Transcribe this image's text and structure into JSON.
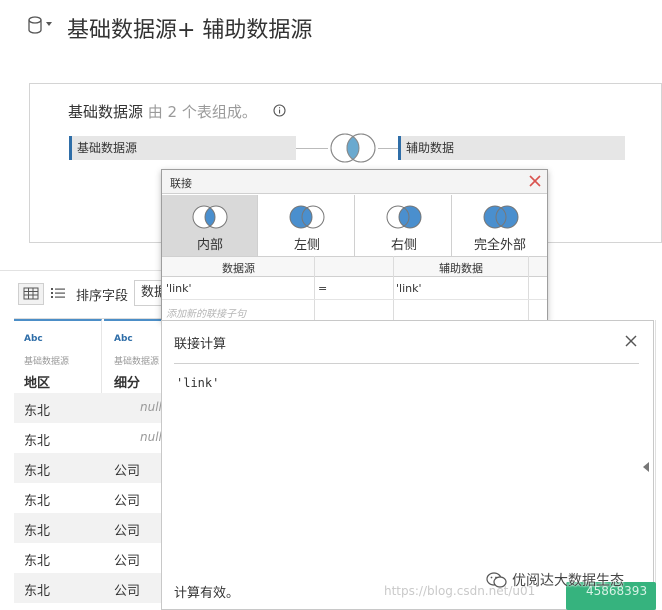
{
  "header": {
    "title": "基础数据源+ 辅助数据源"
  },
  "datasource": {
    "heading_main": "基础数据源",
    "heading_suffix": " 由 2 个表组成。",
    "left_table": "基础数据源",
    "right_table": "辅助数据"
  },
  "toolbar": {
    "sort_label": "排序字段",
    "sort_value": "数据"
  },
  "grid": {
    "columns": [
      {
        "type": "Abc",
        "source": "基础数据源",
        "field": "地区"
      },
      {
        "type": "Abc",
        "source": "基础数据源",
        "field": "细分"
      }
    ],
    "null_text": "null",
    "rows": [
      [
        "东北",
        "null"
      ],
      [
        "东北",
        "null"
      ],
      [
        "东北",
        "公司"
      ],
      [
        "东北",
        "公司"
      ],
      [
        "东北",
        "公司"
      ],
      [
        "东北",
        "公司"
      ],
      [
        "东北",
        "公司"
      ]
    ]
  },
  "join_dialog": {
    "title": "联接",
    "types": [
      {
        "label": "内部",
        "selected": true
      },
      {
        "label": "左侧",
        "selected": false
      },
      {
        "label": "右侧",
        "selected": false
      },
      {
        "label": "完全外部",
        "selected": false
      }
    ],
    "clause_headers": {
      "left": "数据源",
      "right": "辅助数据"
    },
    "clause": {
      "left": "'link'",
      "op": "=",
      "right": "'link'"
    },
    "add_clause": "添加新的联接子句"
  },
  "calc_panel": {
    "title": "联接计算",
    "code": "'link'",
    "status": "计算有效。"
  },
  "footer": {
    "watermark": "https://blog.csdn.net/u01",
    "wechat": "优阅达大数据生态",
    "corner_number": "45868393"
  },
  "colors": {
    "accent": "#4c8ec7",
    "venn_fill": "#4a8fce",
    "ok_green": "#36b37e"
  }
}
